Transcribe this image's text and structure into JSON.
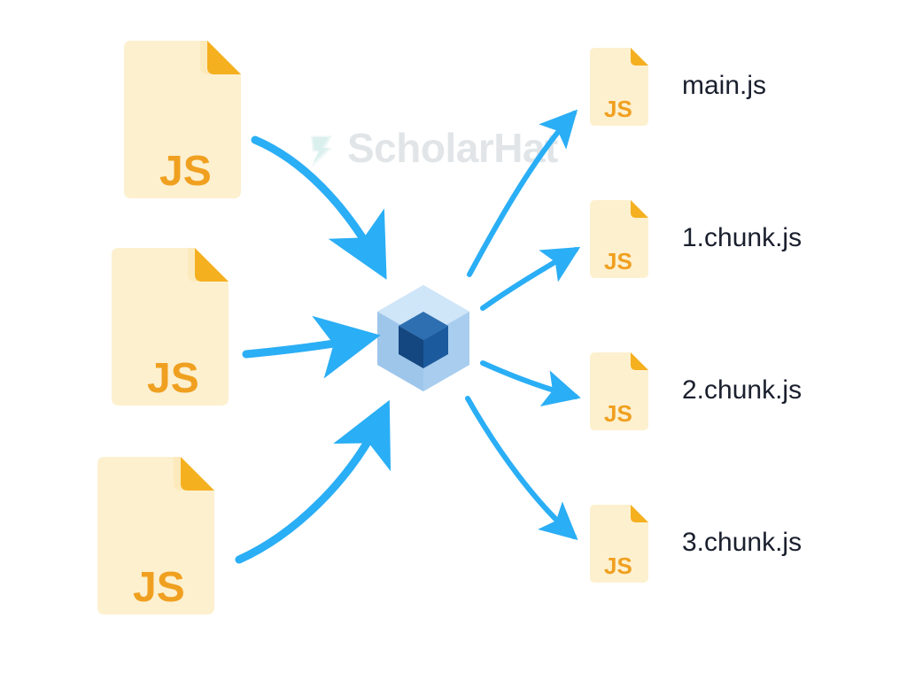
{
  "watermarkText": "ScholarHat",
  "inputs": [
    {
      "label": "JS"
    },
    {
      "label": "JS"
    },
    {
      "label": "JS"
    }
  ],
  "outputs": [
    {
      "file": "JS",
      "name": "main.js"
    },
    {
      "file": "JS",
      "name": "1.chunk.js"
    },
    {
      "file": "JS",
      "name": "2.chunk.js"
    },
    {
      "file": "JS",
      "name": "3.chunk.js"
    }
  ],
  "bundler": "webpack",
  "colors": {
    "fileFill": "#fdf0cf",
    "fileStroke": "#f0a020",
    "fold": "#f5b020",
    "js": "#f0a020",
    "arrow": "#2aaef5",
    "label": "#1a1f2e"
  }
}
